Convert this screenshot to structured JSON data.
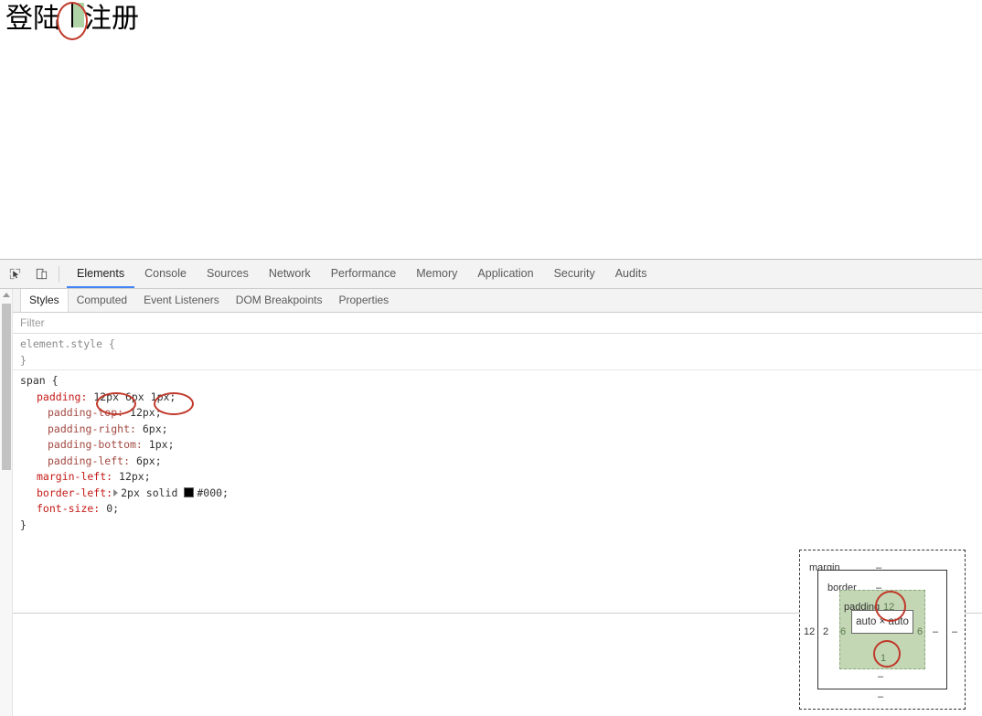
{
  "page": {
    "text_before": "登陆",
    "text_after": "注册",
    "highlighted_span_text": "",
    "highlight_bg": "#aed3a6",
    "border_color": "#000000"
  },
  "annotation": {
    "color": "#c0392b",
    "shape": "ellipse"
  },
  "devtools": {
    "toolbar_icons": [
      {
        "name": "inspect-element-icon",
        "glyph": "inspect"
      },
      {
        "name": "device-toolbar-icon",
        "glyph": "device"
      }
    ],
    "tabs": [
      {
        "label": "Elements",
        "active": true
      },
      {
        "label": "Console",
        "active": false
      },
      {
        "label": "Sources",
        "active": false
      },
      {
        "label": "Network",
        "active": false
      },
      {
        "label": "Performance",
        "active": false
      },
      {
        "label": "Memory",
        "active": false
      },
      {
        "label": "Application",
        "active": false
      },
      {
        "label": "Security",
        "active": false
      },
      {
        "label": "Audits",
        "active": false
      }
    ],
    "sidebar_tabs": [
      {
        "label": "Styles",
        "active": true
      },
      {
        "label": "Computed",
        "active": false
      },
      {
        "label": "Event Listeners",
        "active": false
      },
      {
        "label": "DOM Breakpoints",
        "active": false
      },
      {
        "label": "Properties",
        "active": false
      }
    ],
    "filter": {
      "placeholder": "Filter",
      "value": ""
    },
    "styles": {
      "element_style": {
        "selector": "element.style {",
        "close": "}"
      },
      "span_rule": {
        "selector": "span {",
        "close": "}",
        "declarations": [
          {
            "prop": "padding:",
            "value": "12px 6px 1px;",
            "shorthand": true,
            "dim": false
          },
          {
            "prop": "padding-top:",
            "value": "12px;",
            "shorthand": false,
            "dim": true
          },
          {
            "prop": "padding-right:",
            "value": "6px;",
            "shorthand": false,
            "dim": true
          },
          {
            "prop": "padding-bottom:",
            "value": "1px;",
            "shorthand": false,
            "dim": true
          },
          {
            "prop": "padding-left:",
            "value": "6px;",
            "shorthand": false,
            "dim": true
          },
          {
            "prop": "margin-left:",
            "value": "12px;",
            "shorthand": false,
            "dim": false
          },
          {
            "prop": "border-left:",
            "value": "2px solid #000;",
            "shorthand": false,
            "dim": false
          },
          {
            "prop": "font-size:",
            "value": "0;",
            "shorthand": false,
            "dim": false
          }
        ],
        "border_swatch_color": "#000000",
        "border_value_parts": {
          "width_style": "2px solid",
          "color": "#000;"
        }
      }
    }
  },
  "box_model": {
    "labels": {
      "margin": "margin",
      "border": "border",
      "padding": "padding",
      "content": "auto × auto"
    },
    "margin": {
      "top": "–",
      "right": "–",
      "bottom": "–",
      "left": "12"
    },
    "border": {
      "top": "–",
      "right": "–",
      "bottom": "–",
      "left": "2"
    },
    "padding": {
      "top": "12",
      "right": "6",
      "bottom": "1",
      "left": "6"
    },
    "colors": {
      "padding_fill": "#c3d7b5",
      "content_fill": "#ffffff"
    }
  }
}
